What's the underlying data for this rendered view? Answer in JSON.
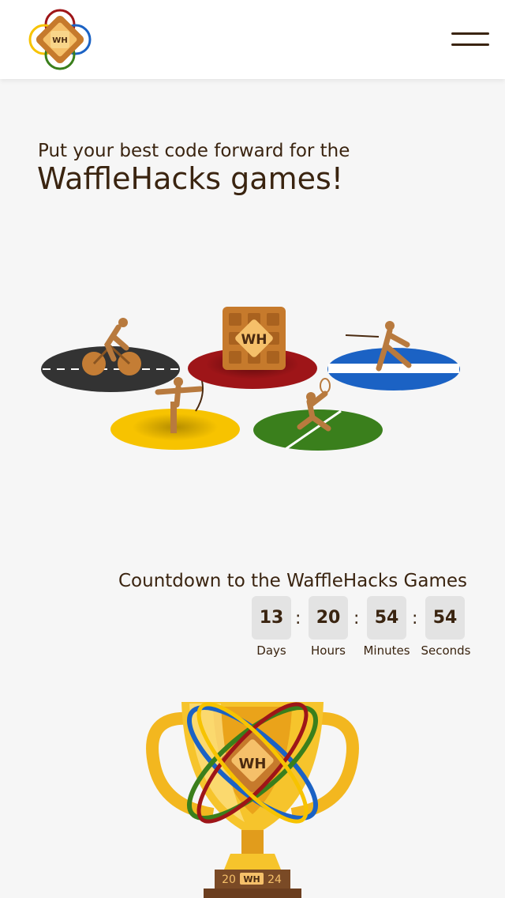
{
  "header": {
    "logo_text": "WH",
    "menu_label": "menu"
  },
  "hero": {
    "subtitle": "Put your best code forward for the",
    "title": "WaffleHacks games!"
  },
  "illustration": {
    "center_text": "WH",
    "colors": {
      "black_ring": "#333333",
      "red_ring": "#9e1518",
      "blue_ring": "#1b62c4",
      "yellow_ring": "#f7c300",
      "green_ring": "#3a7f1c",
      "waffle": "#e0a03e",
      "athlete": "#b87a3e"
    }
  },
  "countdown": {
    "title": "Countdown to the WaffleHacks Games",
    "units": [
      {
        "value": "13",
        "label": "Days"
      },
      {
        "value": "20",
        "label": "Hours"
      },
      {
        "value": "54",
        "label": "Minutes"
      },
      {
        "value": "54",
        "label": "Seconds"
      }
    ],
    "separator": ":"
  },
  "trophy": {
    "logo_text": "WH",
    "year_left": "20",
    "year_logo": "WH",
    "year_right": "24"
  }
}
